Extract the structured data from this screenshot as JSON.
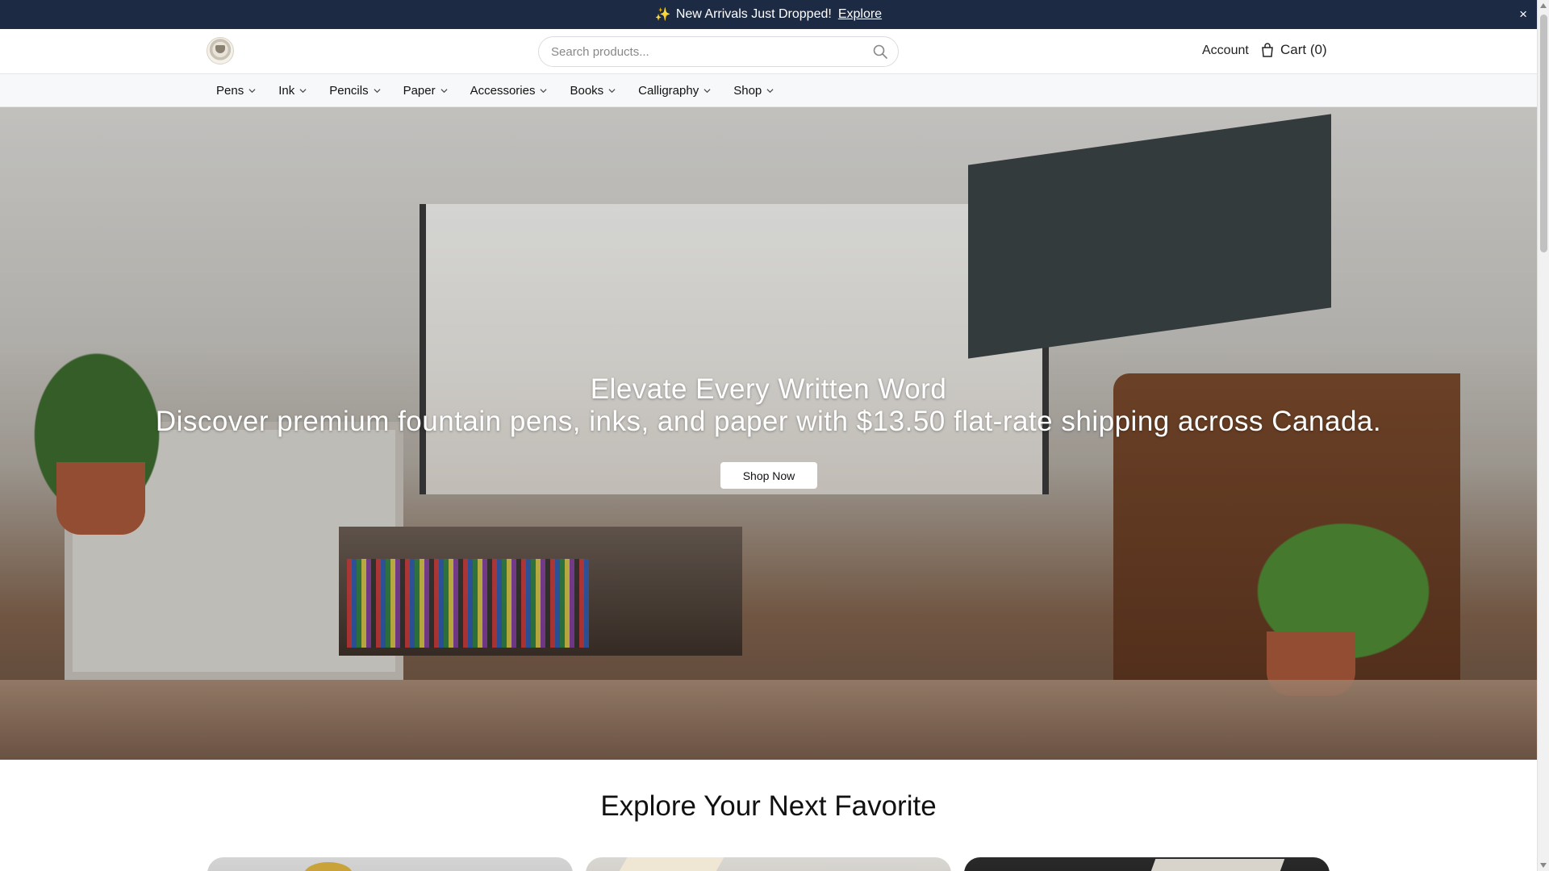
{
  "announcement": {
    "icon": "sparkles-icon",
    "text": "New Arrivals Just Dropped!",
    "link_label": "Explore",
    "close_label": "×"
  },
  "header": {
    "logo": "store-logo",
    "search": {
      "placeholder": "Search products...",
      "value": ""
    },
    "account_label": "Account",
    "cart_label": "Cart (0)"
  },
  "nav": {
    "items": [
      {
        "label": "Pens"
      },
      {
        "label": "Ink"
      },
      {
        "label": "Pencils"
      },
      {
        "label": "Paper"
      },
      {
        "label": "Accessories"
      },
      {
        "label": "Books"
      },
      {
        "label": "Calligraphy"
      },
      {
        "label": "Shop"
      }
    ]
  },
  "hero": {
    "title": "Elevate Every Written Word",
    "subtitle": "Discover premium fountain pens, inks, and paper with $13.50 flat-rate shipping across Canada.",
    "button_label": "Shop Now"
  },
  "section": {
    "title": "Explore Your Next Favorite"
  },
  "colors": {
    "announcement_bg": "#1c2a44",
    "nav_bg": "#f7f8f9",
    "button_bg": "#ffffff"
  }
}
